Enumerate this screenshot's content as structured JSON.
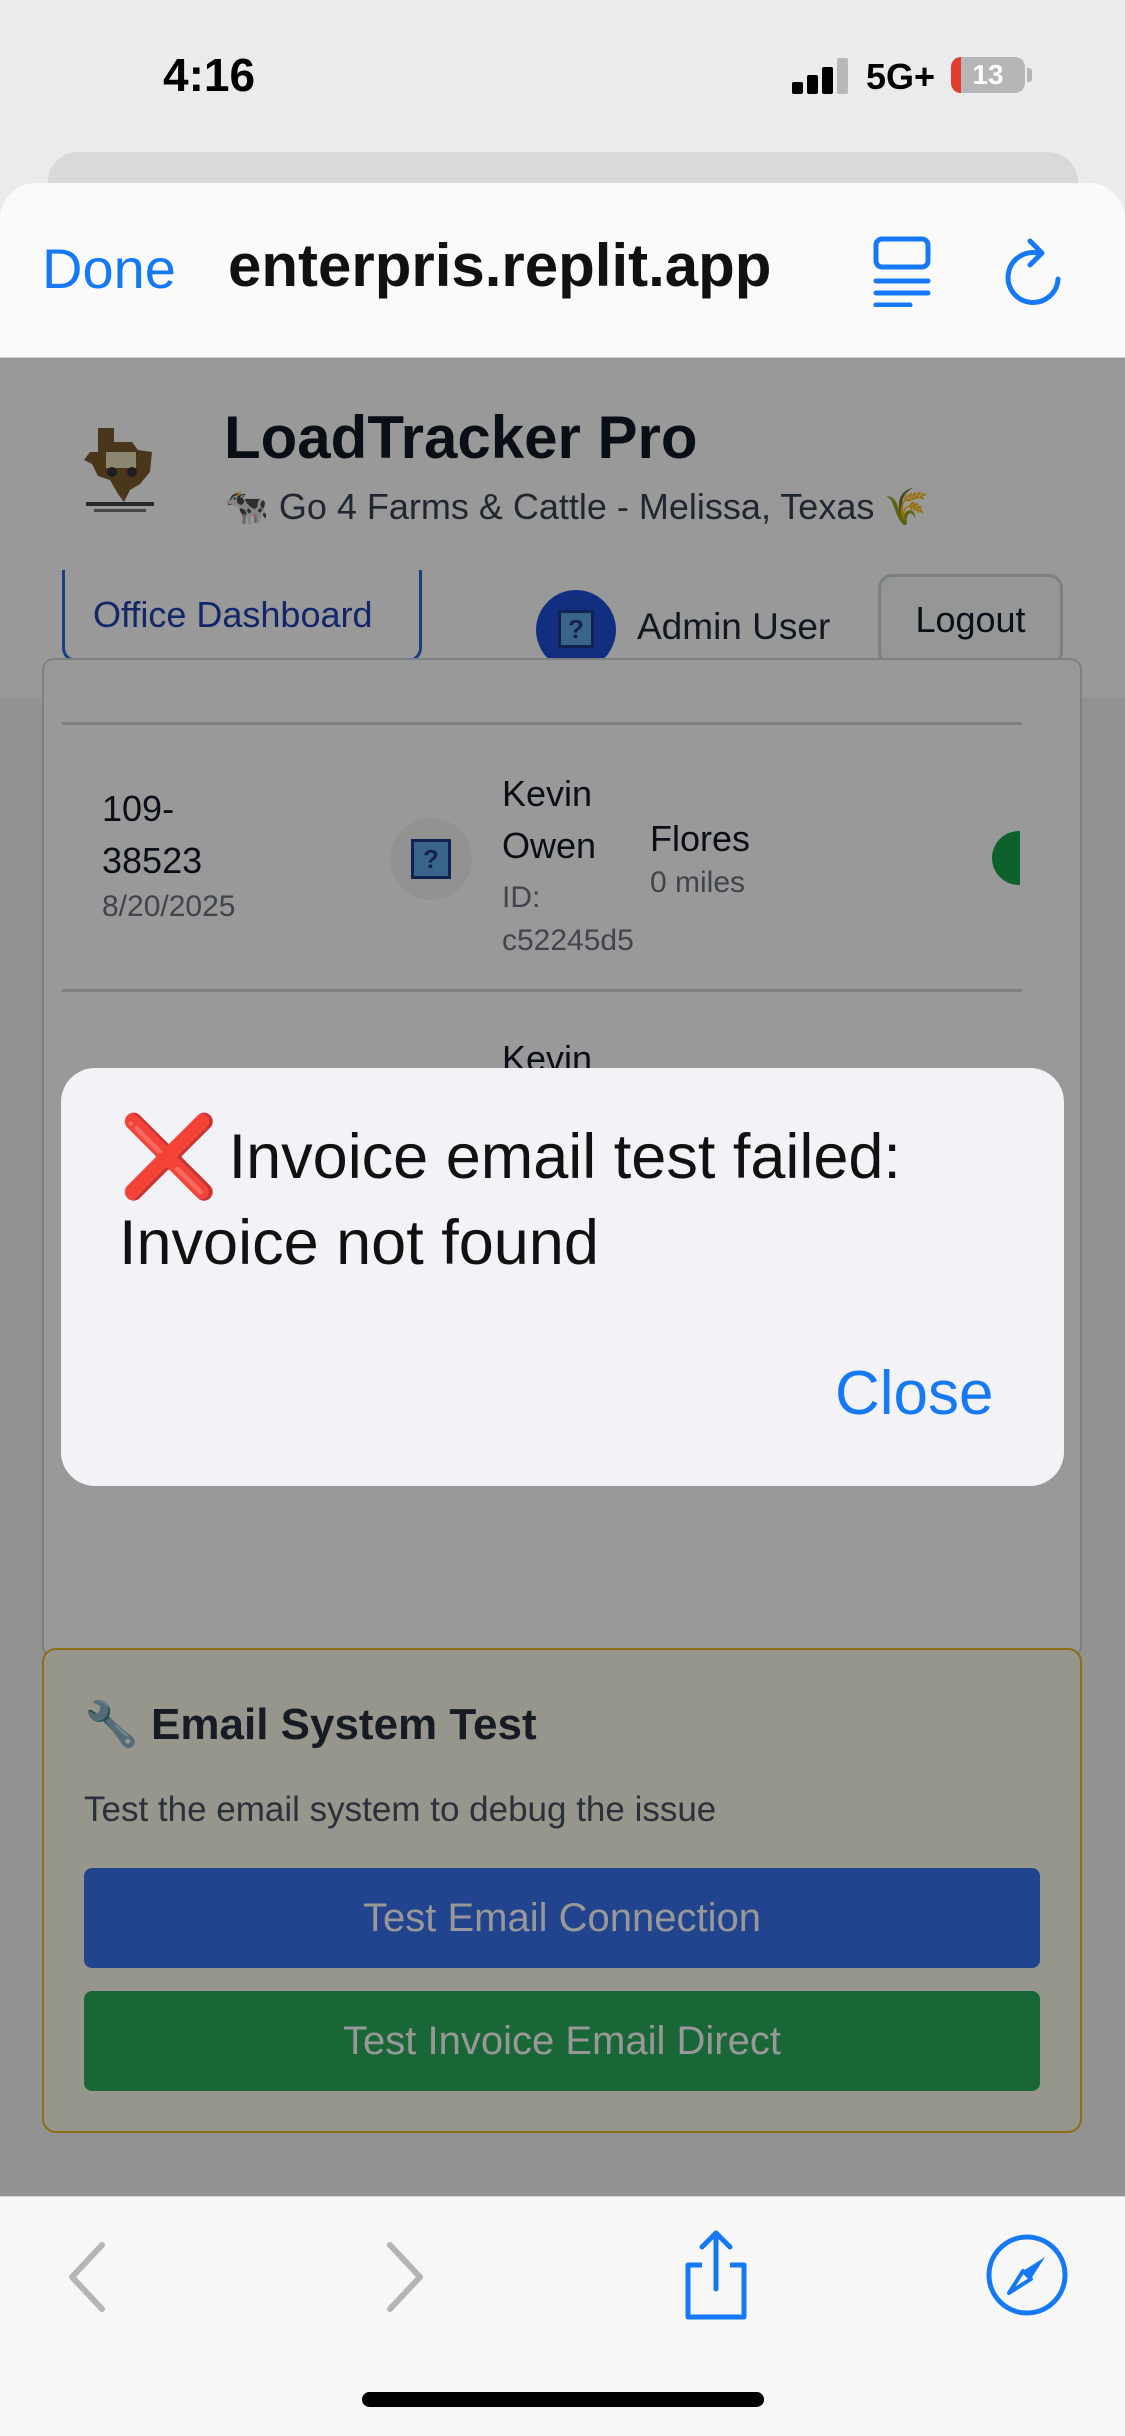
{
  "status_bar": {
    "time": "4:16",
    "network": "5G+",
    "battery": "13"
  },
  "browser": {
    "done_label": "Done",
    "url": "enterpris.replit.app"
  },
  "app": {
    "title": "LoadTracker Pro",
    "subtitle": "🐄 Go 4 Farms & Cattle - Melissa, Texas 🌾"
  },
  "nav": {
    "dashboard_tab": "Office Dashboard",
    "user_name": "Admin User",
    "logout_label": "Logout",
    "avatar_glyph": "?"
  },
  "loads": [
    {
      "number": "109-38523",
      "date": "8/20/2025",
      "driver": "Kevin Owen",
      "driver_id": "ID: c52245d5",
      "destination": "Flores",
      "miles": "0 miles",
      "status_color": "#16a34a"
    },
    {
      "driver_partial": "Kevin"
    }
  ],
  "email_test": {
    "title": "Email System Test",
    "icon": "wrench-icon",
    "description": "Test the email system to debug the issue",
    "test_connection_label": "Test Email Connection",
    "test_invoice_label": "Test Invoice Email Direct"
  },
  "alert": {
    "icon": "❌",
    "message": "Invoice email test failed: Invoice not found",
    "close_label": "Close"
  },
  "colors": {
    "ios_blue": "#1579f5",
    "button_blue": "#2563eb",
    "button_green": "#16a34a",
    "alert_error": "#e11d1d"
  }
}
